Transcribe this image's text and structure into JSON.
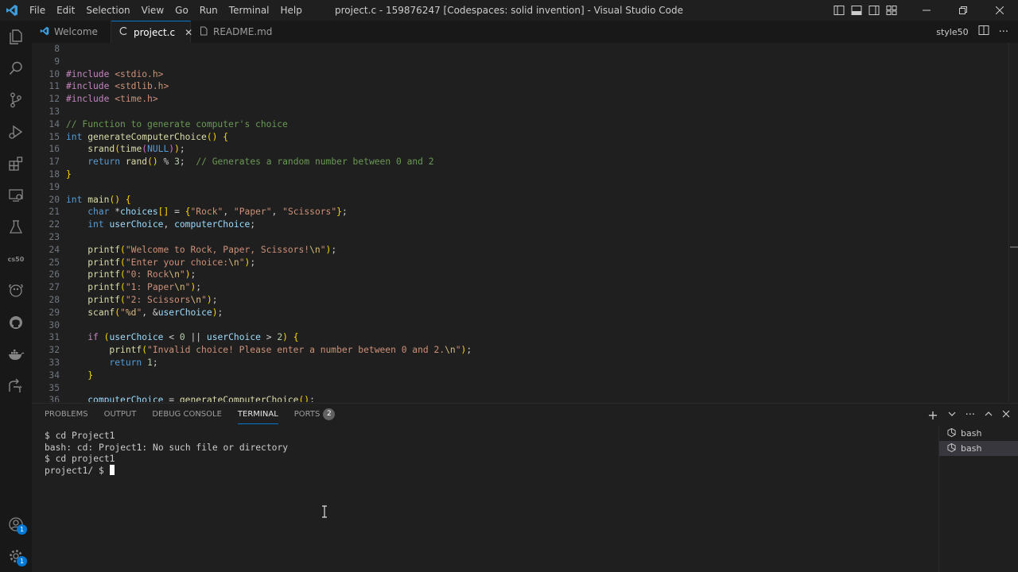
{
  "window": {
    "title": "project.c - 159876247 [Codespaces: solid invention] - Visual Studio Code"
  },
  "menu": [
    "File",
    "Edit",
    "Selection",
    "View",
    "Go",
    "Run",
    "Terminal",
    "Help"
  ],
  "tabs": [
    {
      "label": "Welcome",
      "icon": "vscode-icon"
    },
    {
      "label": "project.c",
      "icon": "c-file-icon",
      "active": true
    },
    {
      "label": "README.md",
      "icon": "markdown-file-icon"
    }
  ],
  "editor_actions": {
    "style_label": "style50"
  },
  "activity_bar": {
    "items": [
      "explorer-icon",
      "search-icon",
      "source-control-icon",
      "run-debug-icon",
      "extensions-icon",
      "remote-explorer-icon",
      "testing-icon",
      "cs50-icon",
      "docker-whale-icon",
      "github-icon",
      "docker-icon",
      "live-share-icon"
    ],
    "cs50_label": "cs50",
    "account_badge": "1",
    "settings_badge": "1"
  },
  "editor": {
    "lines": [
      {
        "n": "8"
      },
      {
        "n": "9"
      },
      {
        "n": "10",
        "t": "#include <stdio.h>"
      },
      {
        "n": "11",
        "t": "#include <stdlib.h>"
      },
      {
        "n": "12",
        "t": "#include <time.h>"
      },
      {
        "n": "13"
      },
      {
        "n": "14",
        "t": "// Function to generate computer's choice"
      },
      {
        "n": "15",
        "t": "int generateComputerChoice() {"
      },
      {
        "n": "16",
        "t": "    srand(time(NULL));"
      },
      {
        "n": "17",
        "t": "    return rand() % 3;  // Generates a random number between 0 and 2"
      },
      {
        "n": "18",
        "t": "}"
      },
      {
        "n": "19"
      },
      {
        "n": "20",
        "t": "int main() {"
      },
      {
        "n": "21",
        "t": "    char *choices[] = {\"Rock\", \"Paper\", \"Scissors\"};"
      },
      {
        "n": "22",
        "t": "    int userChoice, computerChoice;"
      },
      {
        "n": "23"
      },
      {
        "n": "24",
        "t": "    printf(\"Welcome to Rock, Paper, Scissors!\\n\");"
      },
      {
        "n": "25",
        "t": "    printf(\"Enter your choice:\\n\");"
      },
      {
        "n": "26",
        "t": "    printf(\"0: Rock\\n\");"
      },
      {
        "n": "27",
        "t": "    printf(\"1: Paper\\n\");"
      },
      {
        "n": "28",
        "t": "    printf(\"2: Scissors\\n\");"
      },
      {
        "n": "29",
        "t": "    scanf(\"%d\", &userChoice);"
      },
      {
        "n": "30"
      },
      {
        "n": "31",
        "t": "    if (userChoice < 0 || userChoice > 2) {"
      },
      {
        "n": "32",
        "t": "        printf(\"Invalid choice! Please enter a number between 0 and 2.\\n\");"
      },
      {
        "n": "33",
        "t": "        return 1;"
      },
      {
        "n": "34",
        "t": "    }"
      },
      {
        "n": "35"
      },
      {
        "n": "36",
        "t": "    computerChoice = generateComputerChoice();"
      }
    ]
  },
  "panel": {
    "tabs": [
      "PROBLEMS",
      "OUTPUT",
      "DEBUG CONSOLE",
      "TERMINAL",
      "PORTS"
    ],
    "active_tab": "TERMINAL",
    "ports_badge": "2",
    "terminal_lines": [
      "$ cd Project1",
      "bash: cd: Project1: No such file or directory",
      "$ cd project1",
      "project1/ $ "
    ],
    "terminals": [
      "bash",
      "bash"
    ]
  },
  "colors": {
    "accent": "#0078d4",
    "background": "#1f1f1f"
  }
}
